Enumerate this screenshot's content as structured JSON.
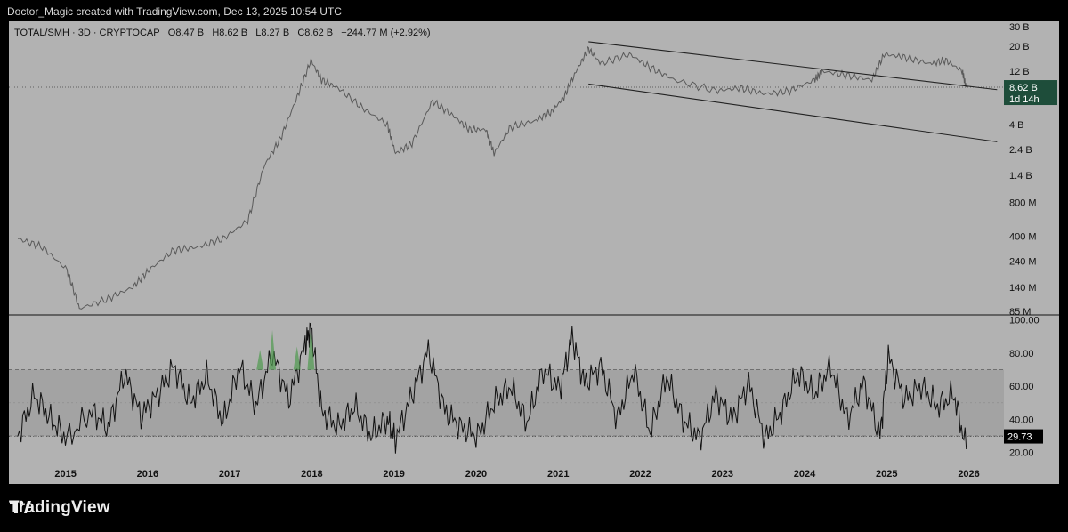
{
  "header": {
    "attribution": "Doctor_Magic created with TradingView.com, Dec 13, 2025 10:54 UTC"
  },
  "symbol": {
    "name": "TOTAL/SMH · 3D · CRYPTOCAP",
    "open": "O8.47 B",
    "high": "H8.62 B",
    "low": "L8.27 B",
    "close": "C8.62 B",
    "change": "+244.77 M (+2.92%)"
  },
  "price_label": {
    "value": "8.62 B",
    "countdown": "1d 14h"
  },
  "rsi_label": {
    "value": "29.73"
  },
  "footer": {
    "brand": "TradingView"
  },
  "colors": {
    "background": "#b2b2b2",
    "line": "#5a5a5a",
    "rsi_line": "#111111",
    "overbought_fill": "#4e9a4e",
    "band": "#a3a3a3",
    "badge": "#1e4d3a"
  },
  "chart_data": [
    {
      "type": "line",
      "title": "TOTAL/SMH · 3D · CRYPTOCAP",
      "y_scale": "log",
      "y_ticks": [
        "30 B",
        "20 B",
        "12 B",
        "4 B",
        "2.4 B",
        "1.4 B",
        "800 M",
        "400 M",
        "240 M",
        "140 M",
        "85 M"
      ],
      "x_ticks": [
        "2015",
        "2016",
        "2017",
        "2018",
        "2019",
        "2020",
        "2021",
        "2022",
        "2023",
        "2024",
        "2025",
        "2026"
      ],
      "last_value": "8.62 B",
      "series": [
        {
          "x": [
            2014.4,
            2014.7,
            2015.0,
            2015.15,
            2015.5,
            2015.8,
            2016.0,
            2016.3,
            2016.6,
            2016.9,
            2017.2,
            2017.4,
            2017.6,
            2017.8,
            2017.97,
            2018.1,
            2018.3,
            2018.6,
            2018.9,
            2019.0,
            2019.2,
            2019.45,
            2019.7,
            2019.9,
            2020.1,
            2020.2,
            2020.4,
            2020.7,
            2020.9,
            2021.05,
            2021.2,
            2021.35,
            2021.5,
            2021.85,
            2022.1,
            2022.4,
            2022.9,
            2023.2,
            2023.5,
            2023.8,
            2024.1,
            2024.2,
            2024.5,
            2024.8,
            2024.95,
            2025.2,
            2025.5,
            2025.7,
            2025.9,
            2025.95
          ],
          "y": [
            0.38,
            0.32,
            0.2,
            0.09,
            0.11,
            0.14,
            0.2,
            0.3,
            0.32,
            0.38,
            0.55,
            1.7,
            3.0,
            7.0,
            15,
            10,
            8.5,
            5.6,
            4.0,
            2.2,
            2.7,
            6.5,
            4.8,
            3.6,
            3.6,
            2.2,
            3.8,
            4.3,
            5.2,
            7.0,
            12,
            19,
            14,
            17,
            13,
            10,
            8.0,
            8.5,
            7.5,
            8.0,
            10,
            12,
            11,
            10,
            17,
            16,
            14,
            15,
            12,
            8.62
          ]
        }
      ],
      "trendlines": [
        {
          "x": [
            2021.35,
            2026.0
          ],
          "y": [
            22,
            8.2
          ]
        },
        {
          "x": [
            2021.35,
            2026.0
          ],
          "y": [
            9.2,
            2.8
          ]
        }
      ]
    },
    {
      "type": "line",
      "title": "RSI",
      "y_ticks": [
        "100.00",
        "80.00",
        "60.00",
        "40.00",
        "20.00"
      ],
      "ylim": [
        15,
        102
      ],
      "bands": {
        "upper": 70,
        "lower": 30
      },
      "last_value": "29.73",
      "series": [
        {
          "x": [
            2014.4,
            2014.6,
            2014.8,
            2015.0,
            2015.3,
            2015.5,
            2015.7,
            2015.9,
            2016.1,
            2016.3,
            2016.5,
            2016.7,
            2016.9,
            2017.1,
            2017.3,
            2017.5,
            2017.7,
            2017.9,
            2017.97,
            2018.1,
            2018.3,
            2018.5,
            2018.7,
            2018.9,
            2019.0,
            2019.2,
            2019.4,
            2019.6,
            2019.8,
            2020.0,
            2020.2,
            2020.4,
            2020.6,
            2020.8,
            2021.0,
            2021.15,
            2021.3,
            2021.5,
            2021.7,
            2021.9,
            2022.1,
            2022.3,
            2022.5,
            2022.7,
            2022.9,
            2023.1,
            2023.3,
            2023.5,
            2023.7,
            2023.9,
            2024.1,
            2024.3,
            2024.5,
            2024.7,
            2024.9,
            2025.0,
            2025.2,
            2025.4,
            2025.6,
            2025.8,
            2025.95
          ],
          "y": [
            30,
            55,
            40,
            28,
            45,
            35,
            68,
            42,
            55,
            72,
            50,
            66,
            38,
            72,
            48,
            80,
            52,
            85,
            96,
            45,
            35,
            48,
            30,
            40,
            28,
            55,
            82,
            45,
            35,
            30,
            50,
            60,
            38,
            70,
            58,
            90,
            62,
            72,
            40,
            70,
            32,
            66,
            40,
            28,
            55,
            40,
            62,
            28,
            45,
            68,
            55,
            72,
            40,
            62,
            30,
            78,
            52,
            60,
            48,
            55,
            22
          ]
        }
      ]
    }
  ]
}
